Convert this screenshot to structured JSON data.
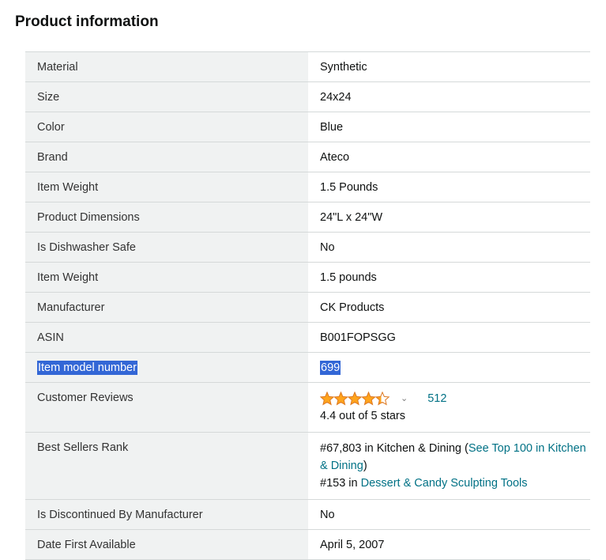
{
  "section_title": "Product information",
  "rows": [
    {
      "label": "Material",
      "value": "Synthetic"
    },
    {
      "label": "Size",
      "value": "24x24"
    },
    {
      "label": "Color",
      "value": "Blue"
    },
    {
      "label": "Brand",
      "value": "Ateco"
    },
    {
      "label": "Item Weight",
      "value": "1.5 Pounds"
    },
    {
      "label": "Product Dimensions",
      "value": "24\"L x 24\"W"
    },
    {
      "label": "Is Dishwasher Safe",
      "value": "No"
    },
    {
      "label": "Item Weight",
      "value": "1.5 pounds"
    },
    {
      "label": "Manufacturer",
      "value": "CK Products"
    },
    {
      "label": "ASIN",
      "value": "B001FOPSGG"
    },
    {
      "label": "Item model number",
      "value": "699"
    }
  ],
  "reviews": {
    "label": "Customer Reviews",
    "rating": 4.4,
    "count": "512",
    "rating_text": "4.4 out of 5 stars",
    "star_color": "#ffa41c"
  },
  "best_sellers": {
    "label": "Best Sellers Rank",
    "rank1_text": "#67,803 in Kitchen & Dining (",
    "rank1_link": "See Top 100 in Kitchen & Dining",
    "rank1_close": ")",
    "rank2_text": "#153 in ",
    "rank2_link": "Dessert & Candy Sculpting Tools"
  },
  "rows_after": [
    {
      "label": "Is Discontinued By Manufacturer",
      "value": "No"
    },
    {
      "label": "Date First Available",
      "value": "April 5, 2007"
    }
  ]
}
